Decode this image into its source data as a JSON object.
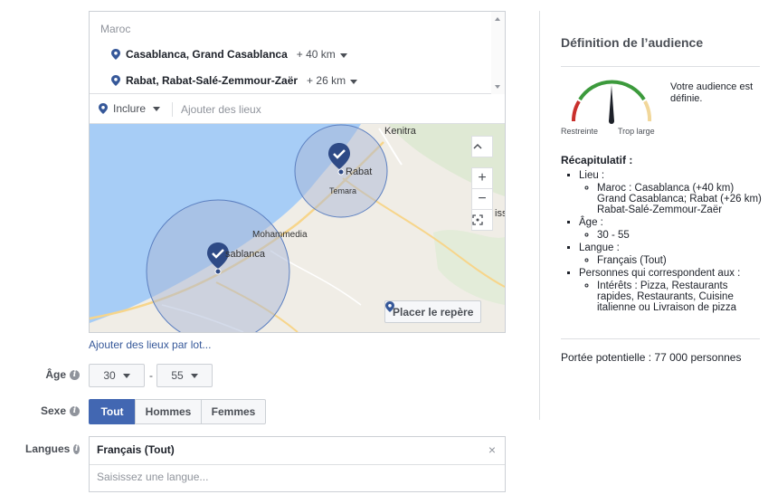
{
  "locations": {
    "country": "Maroc",
    "items": [
      {
        "name": "Casablanca, Grand Casablanca",
        "radius": "+ 40 km"
      },
      {
        "name": "Rabat, Rabat-Salé-Zemmour-Zaër",
        "radius": "+ 26 km"
      }
    ],
    "include_label": "Inclure",
    "add_placeholder": "Ajouter des lieux"
  },
  "map": {
    "labels": [
      "Kenitra",
      "Rabat",
      "Temara",
      "Mohammedia",
      "sablanca",
      "iss"
    ],
    "zoom_in": "+",
    "zoom_out": "−",
    "place_marker": "Placer le repère"
  },
  "bulk_link": "Ajouter des lieux par lot...",
  "age": {
    "label": "Âge",
    "min": "30",
    "max": "55",
    "separator": "-"
  },
  "gender": {
    "label": "Sexe",
    "options": [
      "Tout",
      "Hommes",
      "Femmes"
    ],
    "selected": "Tout"
  },
  "languages": {
    "label": "Langues",
    "selected": "Français (Tout)",
    "placeholder": "Saisissez une langue..."
  },
  "audience": {
    "title": "Définition de l’audience",
    "gauge_status": "Votre audience est définie.",
    "gauge_left": "Restreinte",
    "gauge_right": "Trop large",
    "recap_title": "Récapitulatif :",
    "recap": {
      "lieu_label": "Lieu :",
      "lieu_value": "Maroc : Casablanca (+40 km) Grand Casablanca; Rabat (+26 km) Rabat-Salé-Zemmour-Zaër",
      "age_label": "Âge :",
      "age_value": "30 - 55",
      "langue_label": "Langue :",
      "langue_value": "Français (Tout)",
      "people_label": "Personnes qui correspondent aux :",
      "people_value": "Intérêts : Pizza, Restaurants rapides, Restaurants, Cuisine italienne ou Livraison de pizza"
    },
    "reach": "Portée potentielle : 77 000 personnes"
  },
  "colors": {
    "accent": "#4267b2",
    "link": "#365899",
    "water": "#9fc8f5",
    "circle": "#5b7fc0"
  }
}
